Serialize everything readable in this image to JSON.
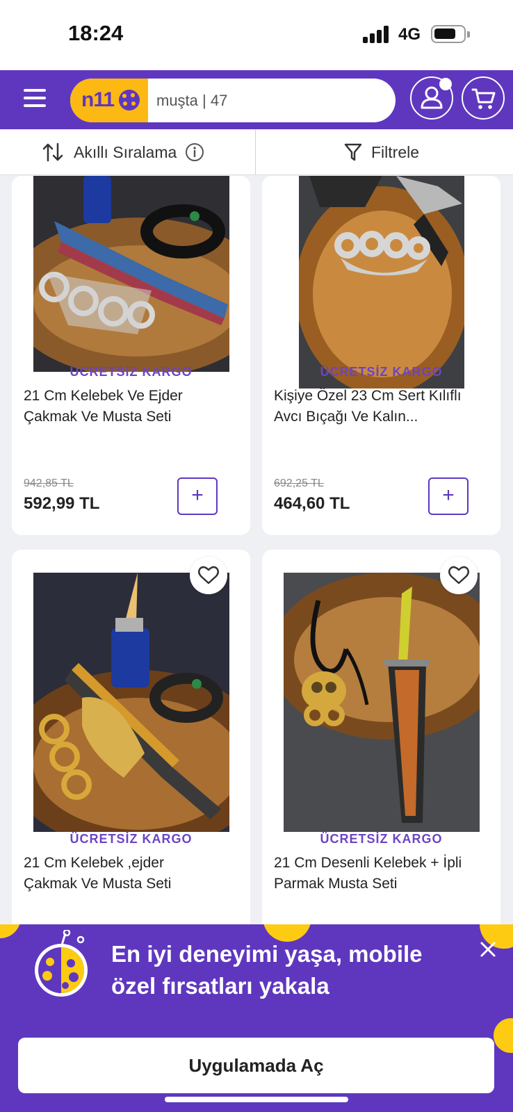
{
  "status_bar": {
    "time": "18:24",
    "network": "4G"
  },
  "header": {
    "logo_text": "n11",
    "search": {
      "value": "muşta | 47",
      "placeholder": ""
    }
  },
  "sort_bar": {
    "sort_label": "Akıllı Sıralama",
    "filter_label": "Filtrele"
  },
  "products": [
    {
      "badge": "ÜCRETSİZ KARGO",
      "title_line1": "21 Cm Kelebek Ve Ejder",
      "title_line2": "Çakmak Ve Musta Seti",
      "old_price": "942,85 TL",
      "price": "592,99 TL"
    },
    {
      "badge": "ÜCRETSİZ KARGO",
      "title_line1": "Kişiye Özel 23 Cm Sert Kılıflı",
      "title_line2": "Avcı Bıçağı Ve Kalın...",
      "old_price": "692,25 TL",
      "price": "464,60 TL"
    },
    {
      "badge": "ÜCRETSİZ KARGO",
      "title_line1": "21 Cm Kelebek ,ejder",
      "title_line2": "Çakmak Ve Musta Seti"
    },
    {
      "badge": "ÜCRETSİZ KARGO",
      "title_line1": "21 Cm Desenli Kelebek + İpli",
      "title_line2": "Parmak Musta Seti"
    }
  ],
  "app_banner": {
    "line1": "En iyi deneyimi yaşa, mobile",
    "line2": "özel fırsatları yakala",
    "button": "Uygulamada Aç"
  },
  "colors": {
    "brand_purple": "#5f37bf",
    "brand_yellow": "#fdb913"
  }
}
